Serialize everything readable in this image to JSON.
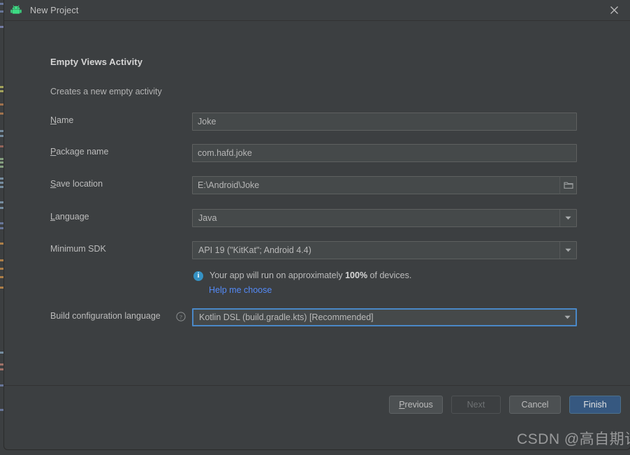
{
  "window": {
    "title": "New Project",
    "app_icon": "android-robot-icon",
    "close_icon": "close-icon"
  },
  "template": {
    "title": "Empty Views Activity",
    "description": "Creates a new empty activity"
  },
  "form": {
    "name": {
      "label": "Name",
      "mnemonic": "N",
      "value": "Joke"
    },
    "package_name": {
      "label": "Package name",
      "mnemonic": "P",
      "value": "com.hafd.joke"
    },
    "save_location": {
      "label": "Save location",
      "mnemonic": "S",
      "value": "E:\\Android\\Joke",
      "browse_icon": "folder-icon"
    },
    "language": {
      "label": "Language",
      "mnemonic": "L",
      "value": "Java",
      "arrow_icon": "chevron-down-icon"
    },
    "minimum_sdk": {
      "label": "Minimum SDK",
      "mnemonic": "",
      "value": "API 19 (\"KitKat\"; Android 4.4)",
      "arrow_icon": "chevron-down-icon"
    },
    "build_config": {
      "label": "Build configuration language",
      "help_icon": "help-circle-icon",
      "value": "Kotlin DSL (build.gradle.kts) [Recommended]",
      "arrow_icon": "chevron-down-icon"
    }
  },
  "info": {
    "icon": "info-circle-icon",
    "text_before": "Your app will run on approximately ",
    "percent": "100%",
    "text_after": " of devices.",
    "link": "Help me choose"
  },
  "footer": {
    "previous": {
      "label": "Previous",
      "mnemonic": "P"
    },
    "next": {
      "label": "Next"
    },
    "cancel": {
      "label": "Cancel"
    },
    "finish": {
      "label": "Finish"
    }
  },
  "watermark": {
    "text": "CSDN @高自期许"
  },
  "colors": {
    "dialog_bg": "#3c3f41",
    "field_bg": "#45494a",
    "accent_blue": "#3592c4",
    "link_blue": "#548af7",
    "focus_blue": "#4a88c7",
    "primary_button": "#365880",
    "android_green": "#3ddc84"
  }
}
